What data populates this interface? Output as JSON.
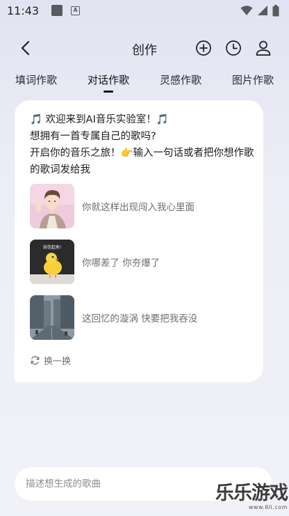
{
  "status_bar": {
    "time": "11:43",
    "icons": [
      "square-notification-icon",
      "a-notification-icon",
      "wifi-icon",
      "signal-icon",
      "battery-icon"
    ]
  },
  "header": {
    "title": "创作",
    "icons": [
      "back-icon",
      "add-circle-icon",
      "history-clock-icon",
      "user-icon"
    ]
  },
  "tabs": [
    {
      "label": "填词作歌",
      "active": false
    },
    {
      "label": "对话作歌",
      "active": true
    },
    {
      "label": "灵感作歌",
      "active": false
    },
    {
      "label": "图片作歌",
      "active": false
    }
  ],
  "card": {
    "welcome_line1": "欢迎来到AI音乐实验室！",
    "welcome_line2": "想拥有一首专属自己的歌吗?",
    "welcome_line3_prefix": "开启你的音乐之旅！",
    "welcome_line3_suffix": "输入一句话或者把你想作歌的歌词发给我",
    "note_glyph": "🎵",
    "pointing_glyph": "👉",
    "suggestions": [
      {
        "text": "你就这样出现闯入我心里面",
        "thumb": "boy-portrait"
      },
      {
        "text": "你哪差了 你夯爆了",
        "thumb": "chick",
        "thumb_caption": "自信起来!"
      },
      {
        "text": "这回忆的漩涡 快要把我吞没",
        "thumb": "city-street"
      }
    ],
    "refresh_label": "换一换"
  },
  "input": {
    "placeholder": "描述想生成的歌曲",
    "value": ""
  },
  "watermark": {
    "main": "乐乐游戏",
    "url": "www.6ll.com"
  },
  "colors": {
    "accent_note": "#1d7ff0",
    "background_top": "#e2e3f2",
    "card": "#ffffff",
    "muted_text": "#6e6e74"
  }
}
